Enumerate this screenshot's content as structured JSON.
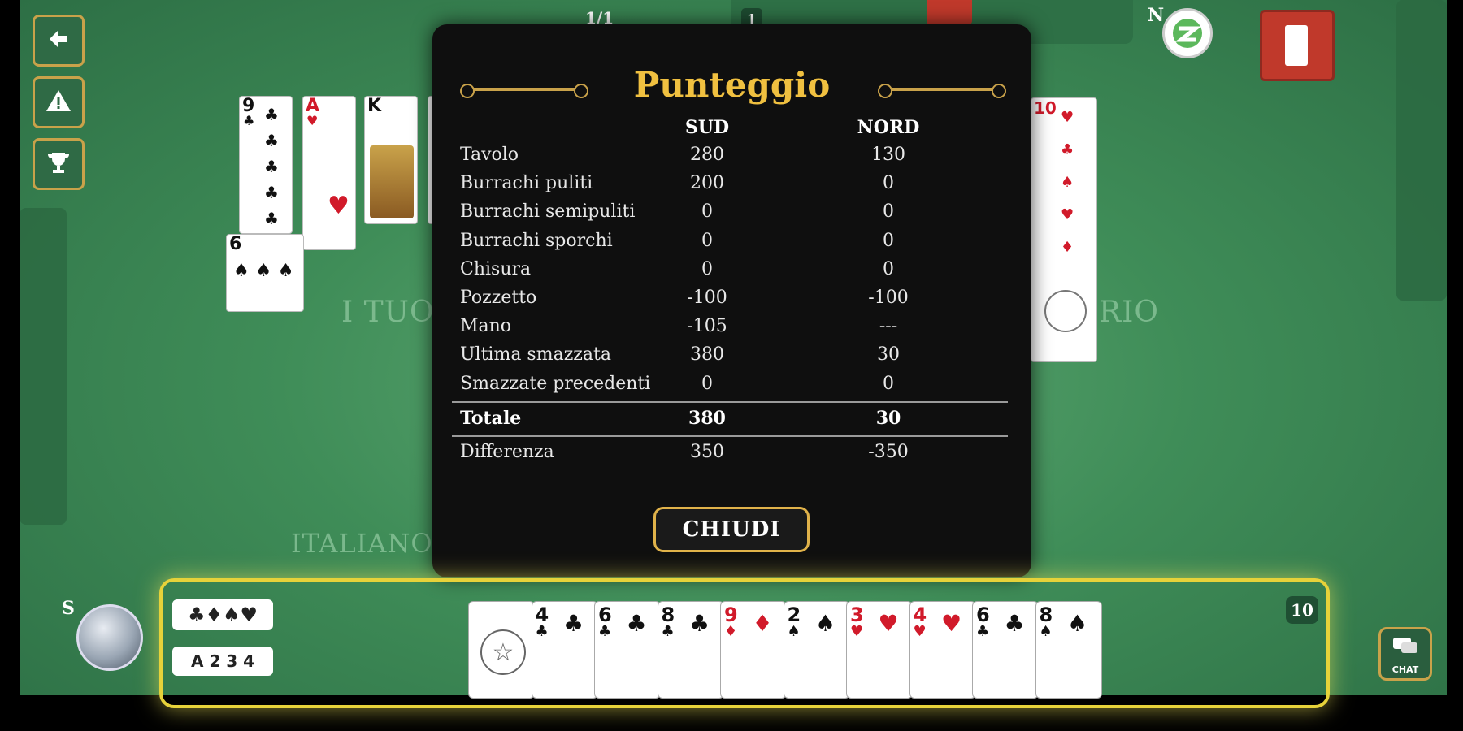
{
  "top": {
    "round_indicator": "1/1",
    "north_player_count": "1",
    "north_seat_letter": "N",
    "south_seat_letter": "S"
  },
  "sidebar": {
    "back_icon": "back-arrow-icon",
    "warning_icon": "warning-icon",
    "trophy_icon": "trophy-icon"
  },
  "table": {
    "left_label": "I TUO",
    "right_label": "RIO",
    "bottom_label": "ITALIANO"
  },
  "modal": {
    "title": "Punteggio",
    "columns": [
      "SUD",
      "NORD"
    ],
    "rows": [
      {
        "label": "Tavolo",
        "sud": "280",
        "nord": "130"
      },
      {
        "label": "Burrachi puliti",
        "sud": "200",
        "nord": "0"
      },
      {
        "label": "Burrachi semipuliti",
        "sud": "0",
        "nord": "0"
      },
      {
        "label": "Burrachi sporchi",
        "sud": "0",
        "nord": "0"
      },
      {
        "label": "Chisura",
        "sud": "0",
        "nord": "0"
      },
      {
        "label": "Pozzetto",
        "sud": "-100",
        "nord": "-100"
      },
      {
        "label": "Mano",
        "sud": "-105",
        "nord": "---"
      },
      {
        "label": "Ultima smazzata",
        "sud": "380",
        "nord": "30"
      },
      {
        "label": "Smazzate precedenti",
        "sud": "0",
        "nord": "0"
      }
    ],
    "total": {
      "label": "Totale",
      "sud": "380",
      "nord": "30"
    },
    "difference": {
      "label": "Differenza",
      "sud": "350",
      "nord": "-350"
    },
    "close_label": "CHIUDI"
  },
  "hand": {
    "card_count": "10",
    "suits_chip": "♣♦♠♥",
    "ranks_chip": "A 2 3 4",
    "cards": [
      {
        "rank": "",
        "suit": "",
        "color": "blk",
        "joker": true
      },
      {
        "rank": "4",
        "suit": "♣",
        "color": "blk"
      },
      {
        "rank": "6",
        "suit": "♣",
        "color": "blk"
      },
      {
        "rank": "8",
        "suit": "♣",
        "color": "blk"
      },
      {
        "rank": "9",
        "suit": "♦",
        "color": "red"
      },
      {
        "rank": "2",
        "suit": "♠",
        "color": "blk"
      },
      {
        "rank": "3",
        "suit": "♥",
        "color": "red"
      },
      {
        "rank": "4",
        "suit": "♥",
        "color": "red"
      },
      {
        "rank": "6",
        "suit": "♣",
        "color": "blk"
      },
      {
        "rank": "8",
        "suit": "♠",
        "color": "blk"
      }
    ]
  },
  "chat_label": "CHAT"
}
